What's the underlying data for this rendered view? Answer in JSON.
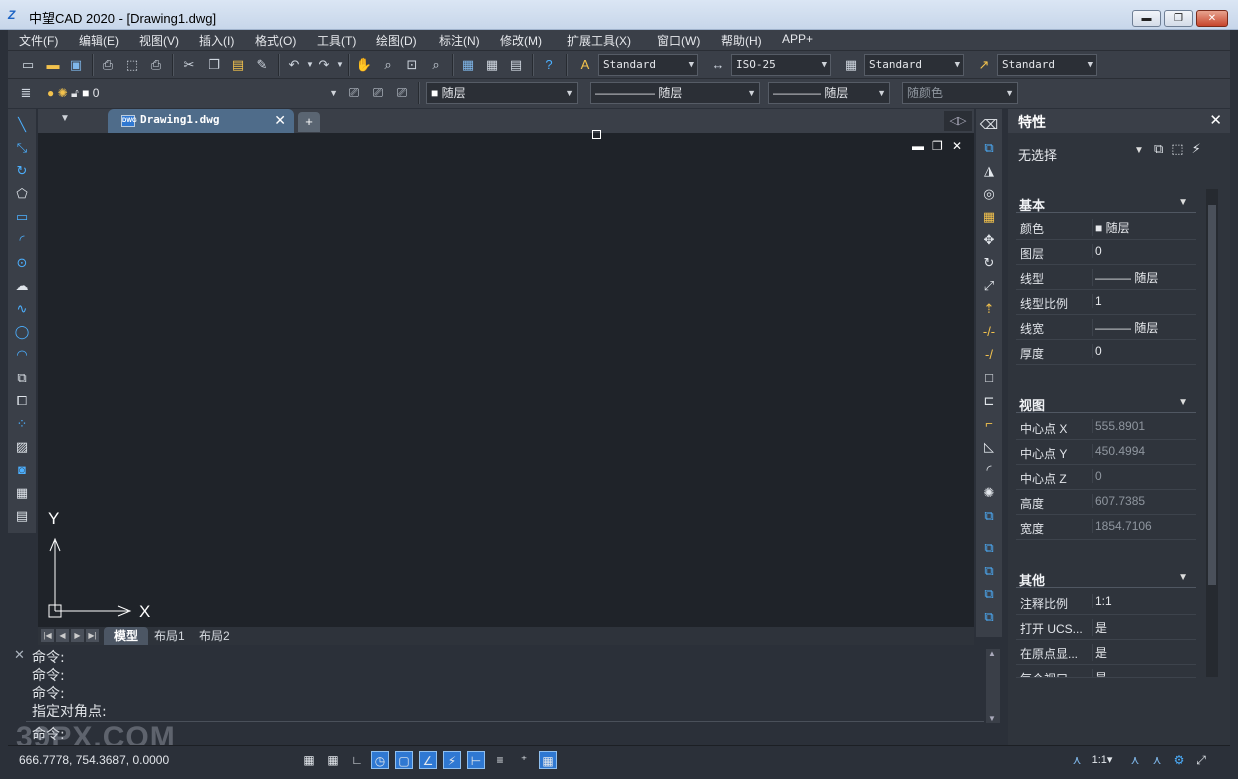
{
  "window": {
    "title": "中望CAD 2020 - [Drawing1.dwg]",
    "minimize": "▬",
    "maximize": "❐",
    "close": "✕"
  },
  "menu": [
    "文件(F)",
    "编辑(E)",
    "视图(V)",
    "插入(I)",
    "格式(O)",
    "工具(T)",
    "绘图(D)",
    "标注(N)",
    "修改(M)",
    "扩展工具(X)",
    "窗口(W)",
    "帮助(H)",
    "APP+"
  ],
  "toolbar": {
    "text_style": "Standard",
    "dim_style": "ISO-25",
    "table_style": "Standard",
    "multileader_style": "Standard",
    "layer": "0",
    "color": "随层",
    "linetype": "随层",
    "lineweight": "随层",
    "plotstyle": "随颜色"
  },
  "document_tab": {
    "name": "Drawing1.dwg",
    "badge": "DWG",
    "close": "✕"
  },
  "ucs": {
    "x": "X",
    "y": "Y"
  },
  "layout_tabs": [
    "模型",
    "布局1",
    "布局2"
  ],
  "command_lines": [
    "命令:",
    "命令:",
    "命令:",
    "指定对角点:"
  ],
  "command_prompt": "命令:",
  "watermark": "39PX.COM",
  "properties": {
    "title": "特性",
    "close": "✕",
    "selection": "无选择",
    "sections": {
      "basic": {
        "title": "基本",
        "rows": [
          {
            "k": "颜色",
            "v": "■ 随层"
          },
          {
            "k": "图层",
            "v": "0"
          },
          {
            "k": "线型",
            "v": "——— 随层"
          },
          {
            "k": "线型比例",
            "v": "1"
          },
          {
            "k": "线宽",
            "v": "——— 随层"
          },
          {
            "k": "厚度",
            "v": "0"
          }
        ]
      },
      "view": {
        "title": "视图",
        "rows": [
          {
            "k": "中心点 X",
            "v": "555.8901"
          },
          {
            "k": "中心点 Y",
            "v": "450.4994"
          },
          {
            "k": "中心点 Z",
            "v": "0"
          },
          {
            "k": "高度",
            "v": "607.7385"
          },
          {
            "k": "宽度",
            "v": "1854.7106"
          }
        ]
      },
      "misc": {
        "title": "其他",
        "rows": [
          {
            "k": "注释比例",
            "v": "1:1"
          },
          {
            "k": "打开 UCS...",
            "v": "是"
          },
          {
            "k": "在原点显...",
            "v": "是"
          },
          {
            "k": "每个视口...",
            "v": "是"
          }
        ]
      }
    }
  },
  "status": {
    "coords": "666.7778, 754.3687, 0.0000",
    "anno_scale": "1:1▾"
  }
}
